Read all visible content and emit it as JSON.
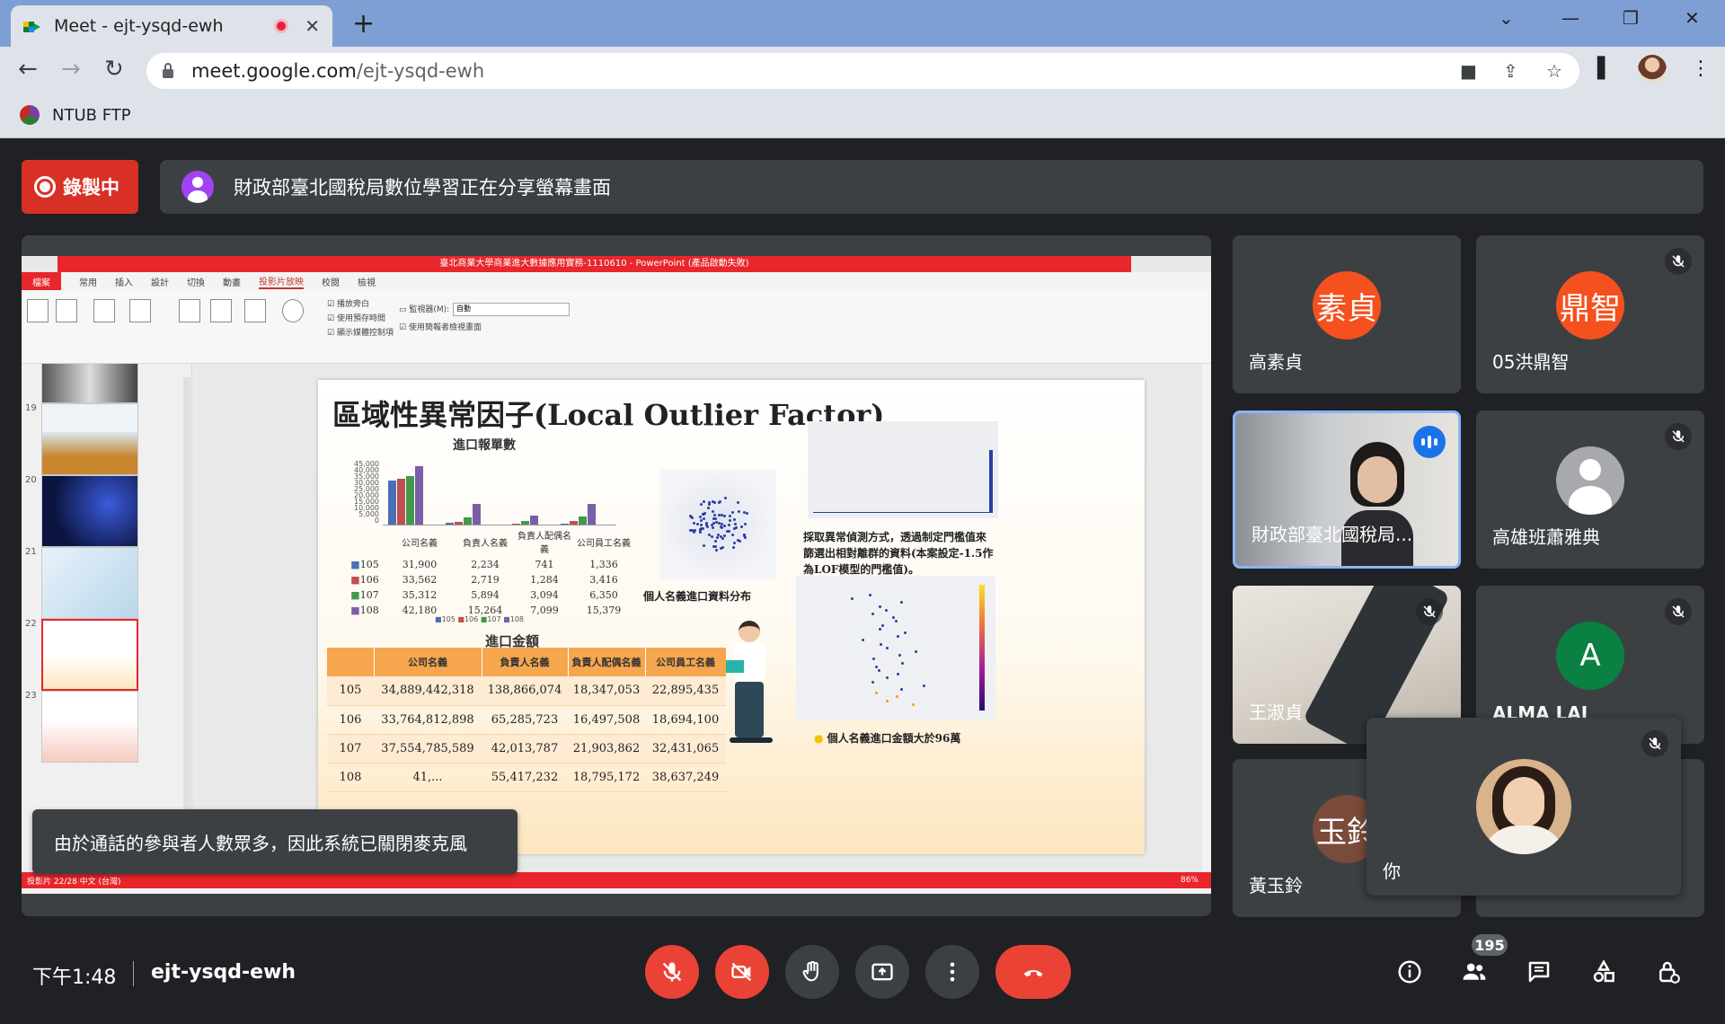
{
  "browser": {
    "tab_title": "Meet - ejt-ysqd-ewh",
    "url_host": "meet.google.com",
    "url_path": "/ejt-ysqd-ewh",
    "bookmark_label": "NTUB FTP",
    "colors": {
      "tabstrip": "#7e9fd3",
      "toolbar": "#dee3ea"
    }
  },
  "meet": {
    "recording_label": "錄製中",
    "presenting_text": "財政部臺北國稅局數位學習正在分享螢幕畫面",
    "toast_text": "由於通話的參與者人數眾多，因此系統已關閉麥克風",
    "time": "下午1:48",
    "meeting_code": "ejt-ysqd-ewh",
    "people_count": "195",
    "participants": [
      {
        "name": "高素貞",
        "initials": "素貞",
        "color": "#f4511e",
        "muted": false
      },
      {
        "name": "05洪鼎智",
        "initials": "鼎智",
        "color": "#f4511e",
        "muted": true
      },
      {
        "name": "財政部臺北國稅局...",
        "video": true,
        "speaking": true
      },
      {
        "name": "高雄班蕭雅典",
        "avatar": "person-placeholder",
        "muted": true
      },
      {
        "name": "王淑貞",
        "video": true,
        "muted": true
      },
      {
        "name": "ALMA LAI",
        "initials": "A",
        "color": "#0b8043",
        "muted": true
      },
      {
        "name": "黃玉鈴",
        "initials": "玉鈴",
        "color": "#7a4a3a",
        "muted": false
      },
      {
        "name": "你",
        "self": true,
        "muted": true
      }
    ]
  },
  "ppt": {
    "window_title": "臺北商業大學商業進大數據應用實務-1110610 - PowerPoint (產品啟動失敗)",
    "ribbon_tabs": [
      "檔案",
      "常用",
      "插入",
      "設計",
      "切換",
      "動畫",
      "投影片放映",
      "校閱",
      "檢視"
    ],
    "statusbar_text": "投影片 22/28    中文 (台灣)",
    "zoom": "86%",
    "thumb_numbers": [
      "19",
      "20",
      "21",
      "22",
      "23"
    ],
    "ribbon_checks": [
      "播放旁白",
      "使用預存時間",
      "顯示媒體控制項",
      "使用簡報者檢視畫面"
    ],
    "monitor_label": "監視器(M):",
    "monitor_value": "自動"
  },
  "slide": {
    "title": "區域性異常因子(Local Outlier Factor)",
    "chart1_title": "進口報單數",
    "chart2_title": "進口金額",
    "scatter_caption": "個人名義進口資料分布",
    "lof_text": "採取異常偵測方式，透過制定門檻值來篩選出相對離群的資料(本案設定-1.5作為LOF模型的門檻值)。",
    "bottom_caption": "個人名義進口金額大於96萬",
    "small_table": {
      "headers": [
        "公司名義",
        "負責人名義",
        "負責人配偶名義",
        "公司員工名義"
      ],
      "rows": [
        {
          "year": "105",
          "values": [
            "31,900",
            "2,234",
            "741",
            "1,336"
          ]
        },
        {
          "year": "106",
          "values": [
            "33,562",
            "2,719",
            "1,284",
            "3,416"
          ]
        },
        {
          "year": "107",
          "values": [
            "35,312",
            "5,894",
            "3,094",
            "6,350"
          ]
        },
        {
          "year": "108",
          "values": [
            "42,180",
            "15,264",
            "7,099",
            "15,379"
          ]
        }
      ],
      "legend": [
        "105",
        "106",
        "107",
        "108"
      ]
    },
    "big_table": {
      "headers": [
        "公司名義",
        "負責人名義",
        "負責人配偶名義",
        "公司員工名義"
      ],
      "rows": [
        {
          "year": "105",
          "values": [
            "34,889,442,318",
            "138,866,074",
            "18,347,053",
            "22,895,435"
          ]
        },
        {
          "year": "106",
          "values": [
            "33,764,812,898",
            "65,285,723",
            "16,497,508",
            "18,694,100"
          ]
        },
        {
          "year": "107",
          "values": [
            "37,554,785,589",
            "42,013,787",
            "21,903,862",
            "32,431,065"
          ]
        },
        {
          "year": "108",
          "values": [
            "41,...",
            "55,417,232",
            "18,795,172",
            "38,637,249"
          ]
        }
      ]
    },
    "chart_data": {
      "type": "bar",
      "title": "進口報單數",
      "categories": [
        "公司名義",
        "負責人名義",
        "負責人配偶名義",
        "公司員工名義"
      ],
      "series": [
        {
          "name": "105",
          "values": [
            31900,
            2234,
            741,
            1336
          ]
        },
        {
          "name": "106",
          "values": [
            33562,
            2719,
            1284,
            3416
          ]
        },
        {
          "name": "107",
          "values": [
            35312,
            5894,
            3094,
            6350
          ]
        },
        {
          "name": "108",
          "values": [
            42180,
            15264,
            7099,
            15379
          ]
        }
      ],
      "ylim": [
        0,
        45000
      ],
      "yticks": [
        "45,000",
        "40,000",
        "35,000",
        "30,000",
        "25,000",
        "20,000",
        "15,000",
        "10,000",
        "5,000",
        "0"
      ],
      "series_colors": [
        "#4a6fb5",
        "#c0504d",
        "#3f9a4a",
        "#7b5ea7"
      ]
    }
  }
}
